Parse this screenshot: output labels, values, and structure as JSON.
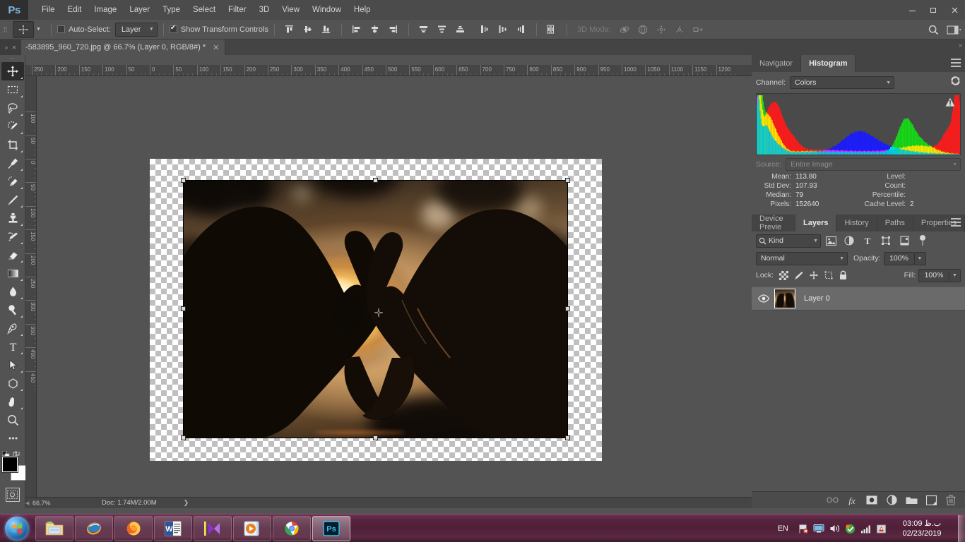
{
  "app": {
    "logo": "Ps",
    "menus": [
      "File",
      "Edit",
      "Image",
      "Layer",
      "Type",
      "Select",
      "Filter",
      "3D",
      "View",
      "Window",
      "Help"
    ],
    "window_controls": {
      "minimize": "—",
      "restore": "❐",
      "close": "✕"
    }
  },
  "options_bar": {
    "tool_icon": "move-tool-icon",
    "auto_select_label": "Auto-Select:",
    "auto_select_checked": false,
    "auto_select_value": "Layer",
    "show_transform_label": "Show Transform Controls",
    "show_transform_checked": true,
    "align_icons": [
      "align-top-edges-icon",
      "align-vertical-centers-icon",
      "align-bottom-edges-icon",
      "align-left-edges-icon",
      "align-horizontal-centers-icon",
      "align-right-edges-icon"
    ],
    "distribute_icons": [
      "distribute-top-edges-icon",
      "distribute-vertical-centers-icon",
      "distribute-bottom-edges-icon",
      "distribute-left-edges-icon",
      "distribute-horizontal-centers-icon",
      "distribute-right-edges-icon"
    ],
    "auto_align_icon": "auto-align-layers-icon",
    "three_d_label": "3D Mode:",
    "three_d_icons": [
      "3d-rotate-icon",
      "3d-roll-icon",
      "3d-pan-icon",
      "3d-slide-icon",
      "3d-scale-icon"
    ],
    "search_icon": "search-icon",
    "workspace_icon": "workspace-switcher-icon"
  },
  "document_tab": {
    "title": "-583895_960_720.jpg @ 66.7% (Layer 0, RGB/8#) *",
    "close": "✕",
    "grip": "»",
    "grip_close": "✕"
  },
  "toolbar": {
    "tools": [
      {
        "name": "move-tool",
        "label": "Move Tool",
        "active": true,
        "has_submenu": true
      },
      {
        "name": "rectangular-marquee-tool",
        "label": "Rectangular Marquee Tool",
        "active": false,
        "has_submenu": true
      },
      {
        "name": "lasso-tool",
        "label": "Lasso Tool",
        "active": false,
        "has_submenu": true
      },
      {
        "name": "quick-selection-tool",
        "label": "Quick Selection Tool",
        "active": false,
        "has_submenu": true
      },
      {
        "name": "crop-tool",
        "label": "Crop Tool",
        "active": false,
        "has_submenu": true
      },
      {
        "name": "eyedropper-tool",
        "label": "Eyedropper Tool",
        "active": false,
        "has_submenu": true
      },
      {
        "name": "spot-healing-brush-tool",
        "label": "Spot Healing Brush Tool",
        "active": false,
        "has_submenu": true
      },
      {
        "name": "brush-tool",
        "label": "Brush Tool",
        "active": false,
        "has_submenu": true
      },
      {
        "name": "clone-stamp-tool",
        "label": "Clone Stamp Tool",
        "active": false,
        "has_submenu": true
      },
      {
        "name": "history-brush-tool",
        "label": "History Brush Tool",
        "active": false,
        "has_submenu": true
      },
      {
        "name": "eraser-tool",
        "label": "Eraser Tool",
        "active": false,
        "has_submenu": true
      },
      {
        "name": "gradient-tool",
        "label": "Gradient Tool",
        "active": false,
        "has_submenu": true
      },
      {
        "name": "blur-tool",
        "label": "Blur Tool",
        "active": false,
        "has_submenu": true
      },
      {
        "name": "dodge-tool",
        "label": "Dodge Tool",
        "active": false,
        "has_submenu": true
      },
      {
        "name": "pen-tool",
        "label": "Pen Tool",
        "active": false,
        "has_submenu": true
      },
      {
        "name": "horizontal-type-tool",
        "label": "Horizontal Type Tool",
        "active": false,
        "has_submenu": true
      },
      {
        "name": "path-selection-tool",
        "label": "Path Selection Tool",
        "active": false,
        "has_submenu": true
      },
      {
        "name": "polygon-tool",
        "label": "Polygon Tool",
        "active": false,
        "has_submenu": true
      },
      {
        "name": "hand-tool",
        "label": "Hand Tool",
        "active": false,
        "has_submenu": true
      },
      {
        "name": "zoom-tool",
        "label": "Zoom Tool",
        "active": false,
        "has_submenu": false
      },
      {
        "name": "edit-toolbar",
        "label": "Edit Toolbar",
        "active": false,
        "has_submenu": false
      }
    ],
    "foreground_color": "#000000",
    "background_color": "#ffffff",
    "swap_colors_icon": "swap-colors-icon",
    "default_colors_icon": "default-colors-icon",
    "quick_mask_icon": "quick-mask-icon"
  },
  "ruler": {
    "unit": "pixels",
    "h_labels": [
      "250",
      "200",
      "150",
      "100",
      "50",
      "0",
      "50",
      "100",
      "150",
      "200",
      "250",
      "300",
      "350",
      "400",
      "450",
      "500",
      "550",
      "600",
      "650",
      "700",
      "750",
      "800",
      "850",
      "900",
      "950",
      "1000",
      "1050",
      "1100",
      "1150",
      "1200"
    ],
    "v_labels": [
      "100",
      "50",
      "0",
      "50",
      "100",
      "150",
      "200",
      "250",
      "300",
      "350",
      "400",
      "450"
    ]
  },
  "canvas": {
    "zoom": "66.7%",
    "image_alt": "two-hands-forming-heart-silhouette-against-sunset",
    "transform_handles": 8,
    "center_mark_icon": "transform-center-icon"
  },
  "status_bar": {
    "zoom": "66.7%",
    "doc_info": "Doc: 1.74M/2.00M",
    "arrow": "❯"
  },
  "histogram_panel": {
    "tabs": [
      {
        "label": "Navigator",
        "active": false
      },
      {
        "label": "Histogram",
        "active": true
      }
    ],
    "menu_icon": "panel-menu-icon",
    "channel_label": "Channel:",
    "channel_value": "Colors",
    "refresh_icon": "refresh-icon",
    "warning_icon": "cached-data-warning-icon",
    "source_label": "Source:",
    "source_value": "Entire Image",
    "stats": {
      "mean_label": "Mean:",
      "mean_value": "113.80",
      "level_label": "Level:",
      "level_value": "",
      "stddev_label": "Std Dev:",
      "stddev_value": "107.93",
      "count_label": "Count:",
      "count_value": "",
      "median_label": "Median:",
      "median_value": "79",
      "percentile_label": "Percentile:",
      "percentile_value": "",
      "pixels_label": "Pixels:",
      "pixels_value": "152640",
      "cache_label": "Cache Level:",
      "cache_value": "2"
    }
  },
  "layers_panel": {
    "tabs": [
      {
        "label": "Device Previe",
        "active": false
      },
      {
        "label": "Layers",
        "active": true
      },
      {
        "label": "History",
        "active": false
      },
      {
        "label": "Paths",
        "active": false
      },
      {
        "label": "Properties",
        "active": false
      }
    ],
    "menu_icon": "panel-menu-icon",
    "filter_label": "Kind",
    "filter_search_icon": "search-icon",
    "filter_icons": [
      "filter-pixel-icon",
      "filter-adjustment-icon",
      "filter-type-icon",
      "filter-shape-icon",
      "filter-smart-object-icon"
    ],
    "filter_toggle_icon": "filter-toggle-icon",
    "blend_mode": "Normal",
    "opacity_label": "Opacity:",
    "opacity_value": "100%",
    "lock_label": "Lock:",
    "lock_icons": [
      "lock-transparent-pixels-icon",
      "lock-image-pixels-icon",
      "lock-position-icon",
      "lock-artboard-nesting-icon",
      "lock-all-icon"
    ],
    "fill_label": "Fill:",
    "fill_value": "100%",
    "layers": [
      {
        "name": "Layer 0",
        "visible": true,
        "selected": true,
        "thumbnail": "heart-hands-sunset-thumbnail"
      }
    ],
    "footer_icons": [
      "link-layers-icon",
      "add-layer-style-icon",
      "add-layer-mask-icon",
      "new-adjustment-layer-icon",
      "new-group-icon",
      "new-layer-icon",
      "delete-layer-icon"
    ]
  },
  "taskbar": {
    "start_label": "start-orb",
    "items": [
      {
        "name": "windows-explorer",
        "active": false
      },
      {
        "name": "internet-explorer",
        "active": false
      },
      {
        "name": "firefox",
        "active": false
      },
      {
        "name": "microsoft-word",
        "active": false
      },
      {
        "name": "movie-maker",
        "active": false
      },
      {
        "name": "windows-media-player",
        "active": false
      },
      {
        "name": "google-chrome",
        "active": false
      },
      {
        "name": "adobe-photoshop",
        "active": true
      }
    ],
    "language": "EN",
    "tray_icons": [
      "flag-action-center-icon",
      "network-monitor-icon",
      "volume-icon",
      "update-icon",
      "signal-bars-icon",
      "antivirus-icon"
    ],
    "clock_time": "03:09 ب.ظ",
    "clock_date": "02/23/2019",
    "show_desktop": "show-desktop-button"
  },
  "colors": {
    "panel_bg": "#535353",
    "menu_bg": "#4b4b4b",
    "dark_bg": "#2f2f2f",
    "text": "#d4d4d4",
    "accent": "#7fb7e0",
    "taskbar": "#4e2038"
  }
}
